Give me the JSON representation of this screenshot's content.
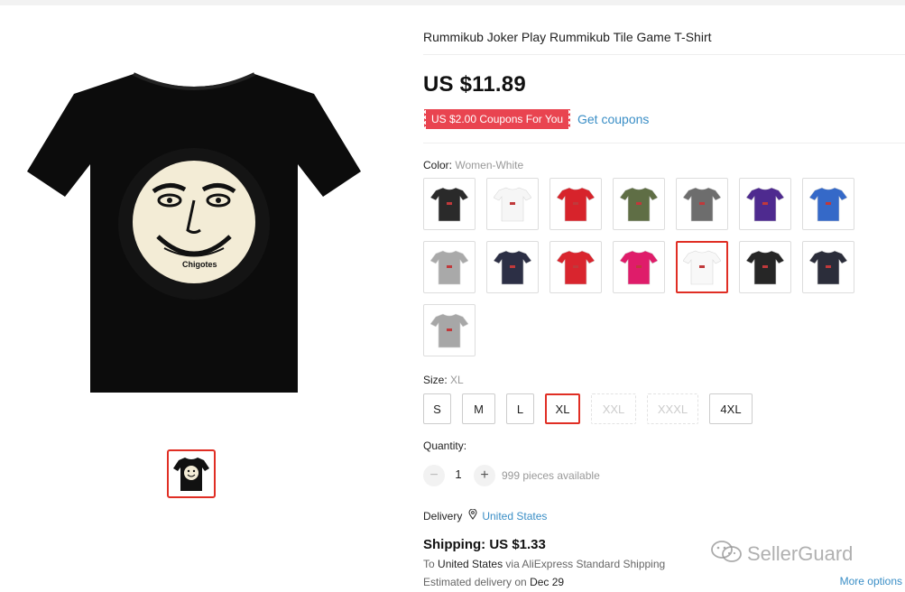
{
  "product": {
    "title": "Rummikub Joker Play Rummikub Tile Game T-Shirt",
    "price": "US $11.89",
    "coupon_badge": "US $2.00 Coupons For You",
    "get_coupons": "Get coupons",
    "shirt_print_text": "Chigotes"
  },
  "color": {
    "label": "Color:",
    "selected": "Women-White",
    "options": [
      {
        "name": "black",
        "hex": "#2a2a2a"
      },
      {
        "name": "white",
        "hex": "#f6f6f6"
      },
      {
        "name": "red",
        "hex": "#d7232b"
      },
      {
        "name": "army-green",
        "hex": "#5f6e45"
      },
      {
        "name": "gray",
        "hex": "#6d6d6d"
      },
      {
        "name": "purple",
        "hex": "#4e2a8f"
      },
      {
        "name": "blue",
        "hex": "#3569c8"
      },
      {
        "name": "light-gray",
        "hex": "#a9a9a9"
      },
      {
        "name": "navy",
        "hex": "#2c2f45"
      },
      {
        "name": "red-2",
        "hex": "#d9252e"
      },
      {
        "name": "pink",
        "hex": "#df1c6a"
      },
      {
        "name": "women-white",
        "hex": "#f8f8f8"
      },
      {
        "name": "black-2",
        "hex": "#262626"
      },
      {
        "name": "navy-2",
        "hex": "#2b2d3a"
      },
      {
        "name": "light-gray-2",
        "hex": "#a7a7a7"
      }
    ]
  },
  "size": {
    "label": "Size:",
    "selected": "XL",
    "options": [
      "S",
      "M",
      "L",
      "XL",
      "XXL",
      "XXXL",
      "4XL"
    ]
  },
  "quantity": {
    "label": "Quantity:",
    "minus": "−",
    "plus": "+",
    "value": "1",
    "available": "999 pieces available"
  },
  "delivery": {
    "label": "Delivery",
    "country": "United States"
  },
  "shipping": {
    "title": "Shipping: US $1.33",
    "to_prefix": "To",
    "to_country": "United States",
    "via": "via AliExpress Standard Shipping",
    "estimated_prefix": "Estimated delivery on",
    "estimated_date": "Dec 29",
    "more_options": "More options"
  },
  "watermark": "SellerGuard",
  "colors": {
    "accent_red": "#e02e24",
    "coupon_red": "#e94450",
    "link_blue": "#3a8ec6"
  }
}
